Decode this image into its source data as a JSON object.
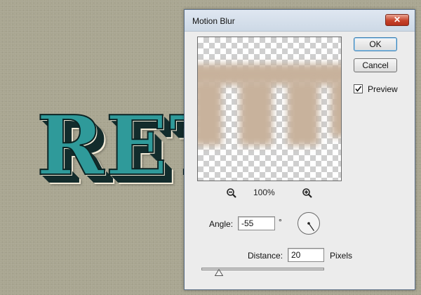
{
  "canvas": {
    "text": "RETRO"
  },
  "dialog": {
    "title": "Motion Blur",
    "close_label": "✕",
    "ok_label": "OK",
    "cancel_label": "Cancel",
    "preview_label": "Preview",
    "preview_checked": true,
    "zoom_level": "100%",
    "angle_label": "Angle:",
    "angle_value": "-55",
    "angle_unit": "°",
    "distance_label": "Distance:",
    "distance_value": "20",
    "distance_unit": "Pixels",
    "distance_slider_fraction": 0.02
  },
  "icons": {
    "zoom_out": "zoom-out-icon",
    "zoom_in": "zoom-in-icon",
    "close": "close-icon",
    "check": "check-icon"
  },
  "colors": {
    "accent_teal": "#2f9a9a",
    "close_red": "#c7432a",
    "blur_tan": "#c8b29c"
  }
}
